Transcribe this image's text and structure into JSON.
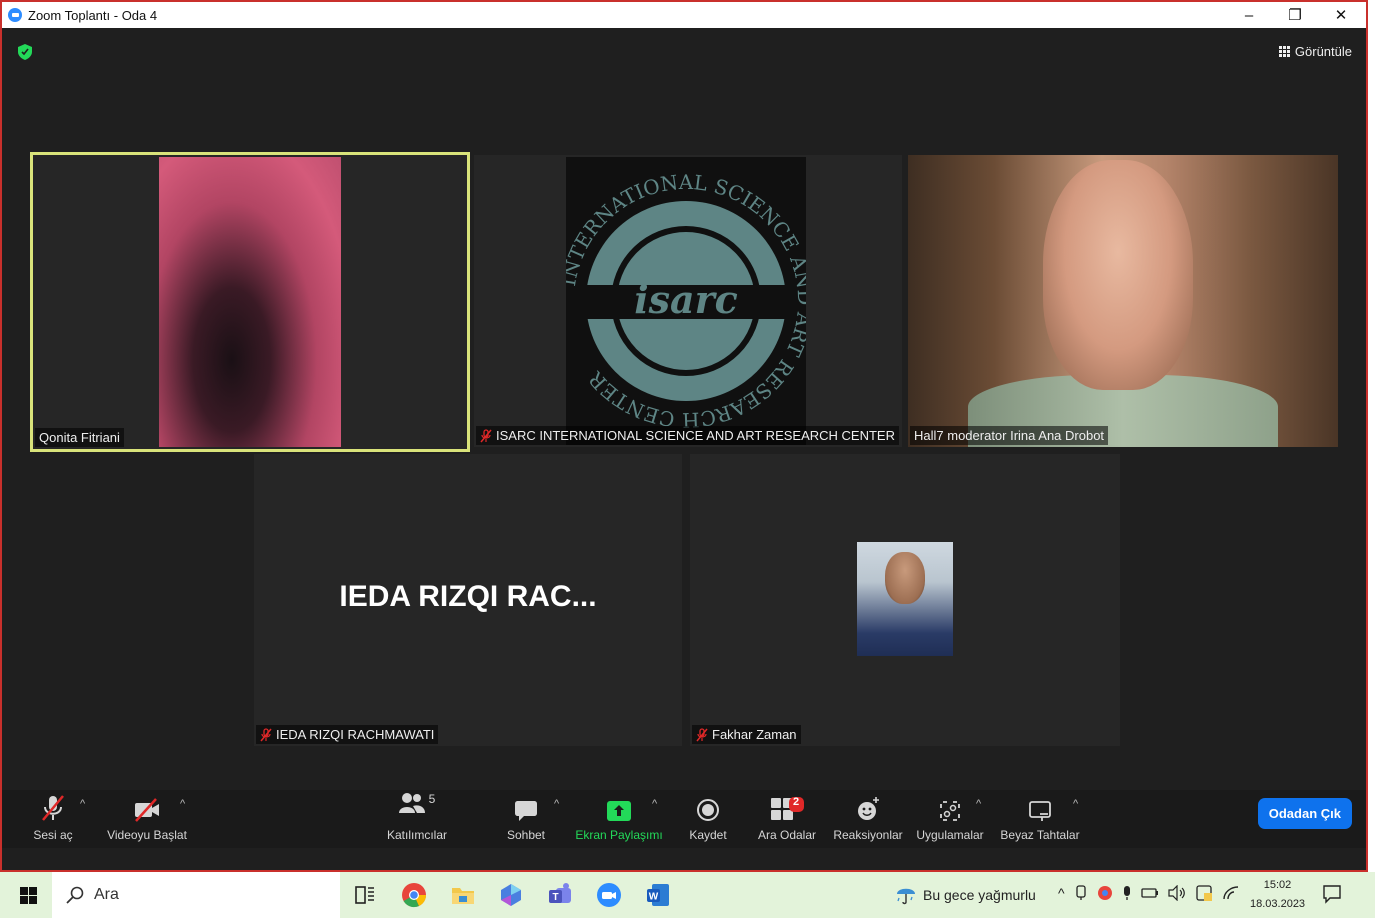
{
  "window": {
    "title": "Zoom Toplantı - Oda 4",
    "controls": {
      "minimize": "–",
      "restore": "❐",
      "close": "✕"
    }
  },
  "meeting": {
    "view_button_label": "Görüntüle",
    "participants_tiles": [
      {
        "name": "Qonita Fitriani",
        "muted": false,
        "active_speaker": true
      },
      {
        "name": "ISARC INTERNATIONAL SCIENCE AND ART RESEARCH CENTER",
        "muted": true,
        "logo_text": "isarc",
        "ring_text": "INTERNATIONAL SCIENCE AND ART RESEARCH CENTER"
      },
      {
        "name": "Hall7 moderator Irina Ana Drobot",
        "muted": false
      },
      {
        "name": "IEDA RIZQI RACHMAWATI",
        "muted": true,
        "display_name_large": "IEDA RIZQI RAC..."
      },
      {
        "name": "Fakhar Zaman",
        "muted": true
      }
    ]
  },
  "toolbar": {
    "unmute": "Sesi aç",
    "start_video": "Videoyu Başlat",
    "participants": "Katılımcılar",
    "participants_count": "5",
    "chat": "Sohbet",
    "share_screen": "Ekran Paylaşımı",
    "record": "Kaydet",
    "breakout_rooms": "Ara Odalar",
    "breakout_badge": "2",
    "reactions": "Reaksiyonlar",
    "apps": "Uygulamalar",
    "whiteboards": "Beyaz Tahtalar",
    "leave": "Odadan Çık",
    "colors": {
      "share_green": "#23d959",
      "leave_blue": "#0e72ed",
      "muted_red": "#e02828"
    }
  },
  "taskbar": {
    "search_placeholder": "Ara",
    "weather_text": "Bu gece yağmurlu",
    "time": "15:02",
    "date": "18.03.2023",
    "apps": [
      "task-view-icon",
      "chrome-icon",
      "file-explorer-icon",
      "copilot-icon",
      "teams-icon",
      "zoom-icon",
      "word-icon"
    ]
  }
}
